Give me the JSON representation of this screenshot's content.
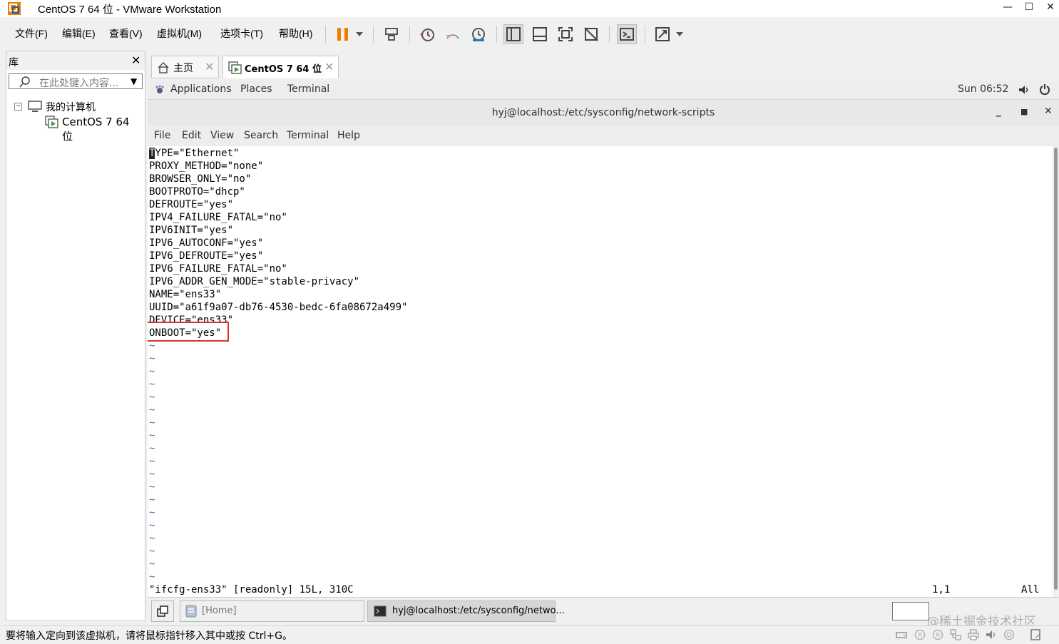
{
  "window": {
    "title": "CentOS 7 64 位 - VMware Workstation"
  },
  "menu": [
    "文件(F)",
    "编辑(E)",
    "查看(V)",
    "虚拟机(M)",
    "选项卡(T)",
    "帮助(H)"
  ],
  "library": {
    "title": "库",
    "search_placeholder": "在此处键入内容...",
    "root": "我的计算机",
    "vm": "CentOS 7 64 位"
  },
  "tabs": {
    "home": "主页",
    "vm": "CentOS 7 64 位"
  },
  "gnome": {
    "menus": [
      "Applications",
      "Places",
      "Terminal"
    ],
    "clock": "Sun 06:52"
  },
  "terminal": {
    "title": "hyj@localhost:/etc/sysconfig/network-scripts",
    "menus": [
      "File",
      "Edit",
      "View",
      "Search",
      "Terminal",
      "Help"
    ],
    "lines": [
      "TYPE=\"Ethernet\"",
      "PROXY_METHOD=\"none\"",
      "BROWSER_ONLY=\"no\"",
      "BOOTPROTO=\"dhcp\"",
      "DEFROUTE=\"yes\"",
      "IPV4_FAILURE_FATAL=\"no\"",
      "IPV6INIT=\"yes\"",
      "IPV6_AUTOCONF=\"yes\"",
      "IPV6_DEFROUTE=\"yes\"",
      "IPV6_FAILURE_FATAL=\"no\"",
      "IPV6_ADDR_GEN_MODE=\"stable-privacy\"",
      "NAME=\"ens33\"",
      "UUID=\"a61f9a07-db76-4530-bedc-6fa08672a499\"",
      "DEVICE=\"ens33\"",
      "ONBOOT=\"yes\""
    ],
    "tilde_char": "~",
    "status_file": "\"ifcfg-ens33\" [readonly] 15L, 310C",
    "status_pos": "1,1",
    "status_all": "All"
  },
  "taskbar": {
    "home": "[Home]",
    "terminal": "hyj@localhost:/etc/sysconfig/netwo..."
  },
  "statusbar": {
    "text": "要将输入定向到该虚拟机，请将鼠标指针移入其中或按 Ctrl+G。"
  },
  "watermark": "@稀土掘金技术社区"
}
